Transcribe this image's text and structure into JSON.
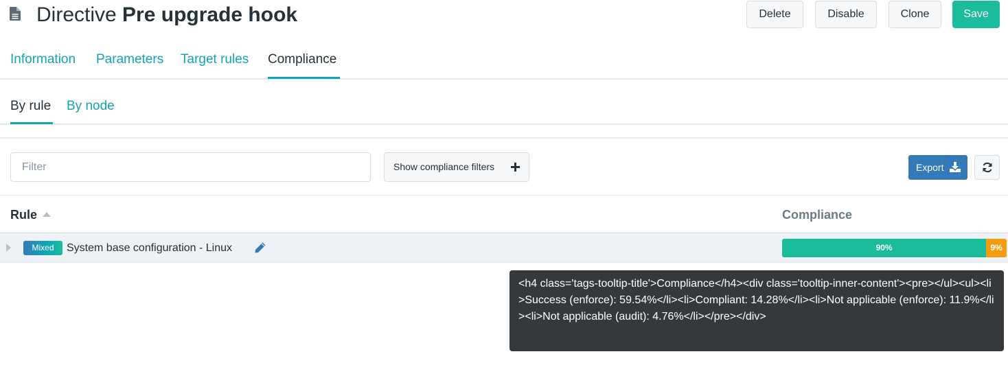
{
  "header": {
    "title_prefix": "Directive",
    "title_name": "Pre upgrade hook",
    "buttons": {
      "delete": "Delete",
      "disable": "Disable",
      "clone": "Clone",
      "save": "Save"
    }
  },
  "tabs": [
    {
      "label": "Information"
    },
    {
      "label": "Parameters"
    },
    {
      "label": "Target rules"
    },
    {
      "label": "Compliance",
      "active": true
    }
  ],
  "subtabs": [
    {
      "label": "By rule",
      "active": true
    },
    {
      "label": "By node"
    }
  ],
  "toolbar": {
    "filter_placeholder": "Filter",
    "filter_value": "",
    "show_filters_label": "Show compliance filters",
    "export_label": "Export"
  },
  "table": {
    "columns": {
      "rule": "Rule",
      "compliance": "Compliance"
    },
    "rows": [
      {
        "badge": "Mixed",
        "name": "System base configuration - Linux",
        "compliance": {
          "segments": [
            {
              "label": "90%",
              "percent": 90,
              "color": "#1abc9c"
            },
            {
              "label": "9%",
              "percent": 9,
              "color": "#f39c12"
            }
          ]
        }
      }
    ]
  },
  "tooltip": {
    "text": "<h4 class='tags-tooltip-title'>Compliance</h4><div class='tooltip-inner-content'><pre></ul><ul><li>Success (enforce): 59.54%</li><li>Compliant: 14.28%</li><li>Not applicable (enforce): 11.9%</li><li>Not applicable (audit): 4.76%</li></pre></div>"
  },
  "icons": {
    "title": "document-icon",
    "filters": "plus-icon",
    "export": "download-icon",
    "refresh": "refresh-icon",
    "edit": "pencil-icon",
    "expand": "caret-right-icon",
    "sort": "sort-up-icon"
  },
  "colors": {
    "accent": "#13a3b5",
    "save": "#1abc9c",
    "export": "#337ab7",
    "success": "#1abc9c",
    "warning": "#f39c12",
    "tooltip": "#36393b"
  }
}
